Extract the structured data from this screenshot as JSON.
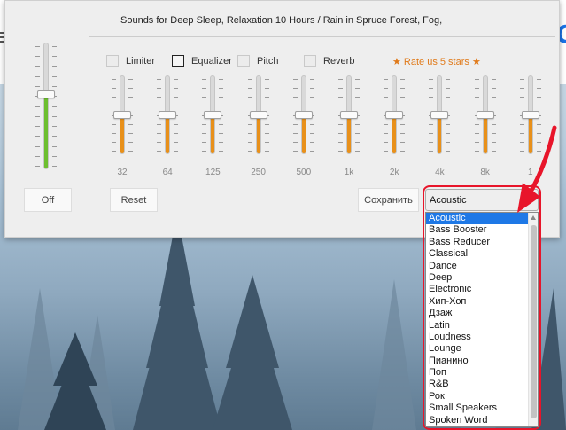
{
  "window": {
    "title": "Sounds for Deep Sleep, Relaxation 10 Hours / Rain in Spruce Forest, Fog,"
  },
  "options": {
    "limiter": {
      "label": "Limiter",
      "checked": false
    },
    "equalizer": {
      "label": "Equalizer",
      "checked": true
    },
    "pitch": {
      "label": "Pitch",
      "checked": false
    },
    "reverb": {
      "label": "Reverb",
      "checked": false
    }
  },
  "rate_label": "★ Rate us 5 stars ★",
  "volume": {
    "level": 0.6,
    "fill_color": "#6dbf2f"
  },
  "bands": [
    {
      "label": "32",
      "level": 0.5
    },
    {
      "label": "64",
      "level": 0.5
    },
    {
      "label": "125",
      "level": 0.5
    },
    {
      "label": "250",
      "level": 0.5
    },
    {
      "label": "500",
      "level": 0.5
    },
    {
      "label": "1k",
      "level": 0.5
    },
    {
      "label": "2k",
      "level": 0.5
    },
    {
      "label": "4k",
      "level": 0.5
    },
    {
      "label": "8k",
      "level": 0.5
    },
    {
      "label": "1",
      "level": 0.5
    }
  ],
  "band_fill_color": "#e8901a",
  "buttons": {
    "off": "Off",
    "reset": "Reset",
    "save": "Сохранить"
  },
  "preset": {
    "selected": "Acoustic",
    "options": [
      "Acoustic",
      "Bass Booster",
      "Bass Reducer",
      "Classical",
      "Dance",
      "Deep",
      "Electronic",
      "Хип-Хоп",
      "Дзаж",
      "Latin",
      "Loudness",
      "Lounge",
      "Пианино",
      "Поп",
      "R&B",
      "Рок",
      "Small Speakers",
      "Spoken Word"
    ]
  },
  "background_logo_text": "G",
  "colors": {
    "annotation_red": "#e8152a",
    "selection_blue": "#1e78e6",
    "rate_orange": "#e07a1a"
  }
}
